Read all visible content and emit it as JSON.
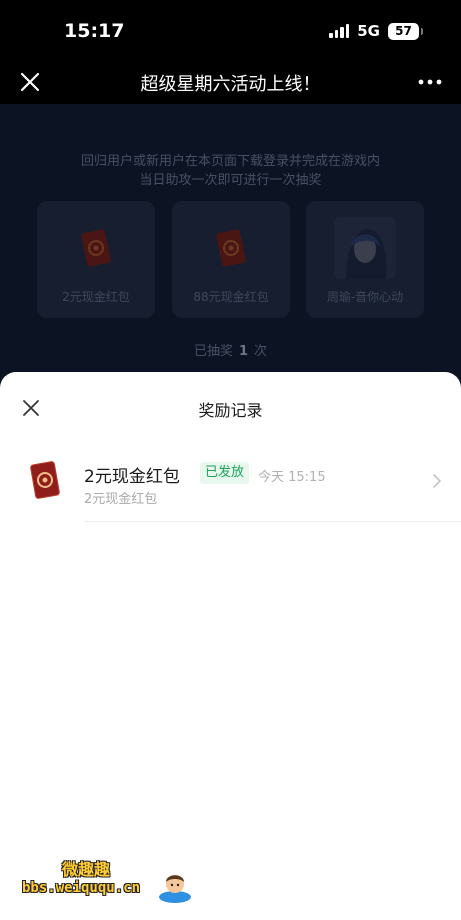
{
  "status_bar": {
    "time": "15:17",
    "network": "5G",
    "battery": "57"
  },
  "nav": {
    "title": "超级星期六活动上线！",
    "close_icon": "close-icon",
    "more_icon": "more-dots-icon"
  },
  "background_page": {
    "hint_line1": "回归用户或新用户在本页面下载登录并完成在游戏内",
    "hint_line2": "当日助攻一次即可进行一次抽奖",
    "prizes": [
      {
        "label": "2元现金红包",
        "icon": "red-envelope-icon"
      },
      {
        "label": "88元现金红包",
        "icon": "red-envelope-icon"
      },
      {
        "label": "周瑜-音你心动",
        "icon": "hero-skin-image"
      }
    ],
    "draw_prefix": "已抽奖",
    "draw_count": "1",
    "draw_suffix": "次"
  },
  "sheet": {
    "title": "奖励记录",
    "close_icon": "close-icon",
    "records": [
      {
        "name": "2元现金红包",
        "badge": "已发放",
        "time": "今天 15:15",
        "subtitle": "2元现金红包",
        "icon": "red-envelope-icon"
      }
    ]
  },
  "watermark": {
    "line1": "微趣趣",
    "url": "bbs.weiququ.cn"
  },
  "colors": {
    "badge_bg": "#e8f8ee",
    "badge_text": "#1da35a",
    "overlay_bg": "#0c1322",
    "envelope": "#8f1d1a"
  }
}
